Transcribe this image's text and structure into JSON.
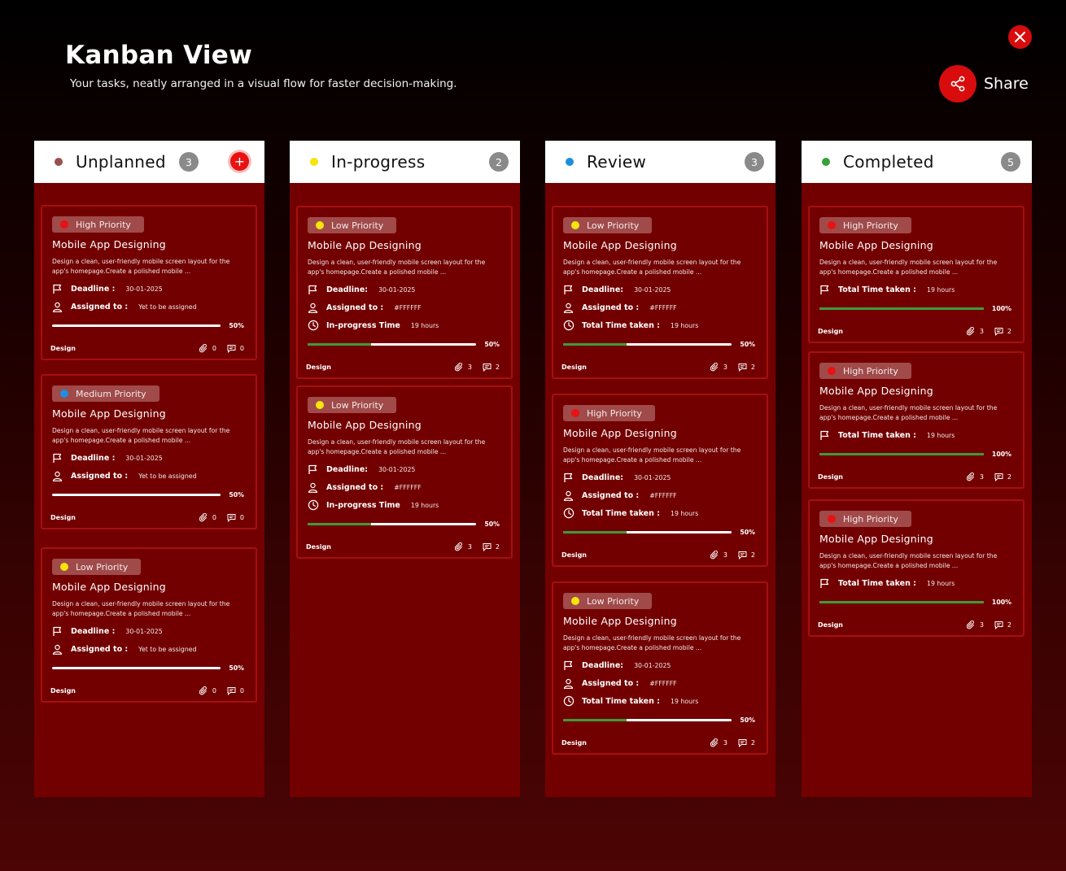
{
  "header": {
    "title": "Kanban View",
    "subtitle": "Your tasks, neatly arranged in a visual flow for faster decision-making.",
    "share_label": "Share"
  },
  "colors": {
    "red": "#e81212",
    "yellow": "#f6e40b",
    "blue": "#1e8fe0",
    "green": "#35a23a",
    "unplanned": "#9a4e4e"
  },
  "columns": [
    {
      "title": "Unplanned",
      "count": "3",
      "cards": [
        {
          "priority": "High Priority",
          "title": "Mobile App Designing",
          "desc": "Design a clean, user-friendly mobile screen layout for the app's homepage.Create a polished mobile ...",
          "deadline_label": "Deadline :",
          "deadline": "30-01-2025",
          "assigned_label": "Assigned to :",
          "assigned": "Yet to be assigned",
          "progress": "50%",
          "progress_value": 0,
          "tag": "Design",
          "attachments": "0",
          "comments": "0"
        },
        {
          "priority": "Medium Priority",
          "title": "Mobile App Designing",
          "desc": "Design a clean, user-friendly mobile screen layout for the app's homepage.Create a polished mobile ...",
          "deadline_label": "Deadline :",
          "deadline": "30-01-2025",
          "assigned_label": "Assigned to :",
          "assigned": "Yet to be assigned",
          "progress": "50%",
          "progress_value": 0,
          "tag": "Design",
          "attachments": "0",
          "comments": "0"
        },
        {
          "priority": "Low Priority",
          "title": "Mobile App Designing",
          "desc": "Design a clean, user-friendly mobile screen layout for the app's homepage.Create a polished mobile ...",
          "deadline_label": "Deadline :",
          "deadline": "30-01-2025",
          "assigned_label": "Assigned to :",
          "assigned": "Yet to be assigned",
          "progress": "50%",
          "progress_value": 0,
          "tag": "Design",
          "attachments": "0",
          "comments": "0"
        }
      ]
    },
    {
      "title": "In-progress",
      "count": "2",
      "cards": [
        {
          "priority": "Low Priority",
          "title": "Mobile App Designing",
          "desc": "Design a clean, user-friendly mobile screen layout for the app's homepage.Create a polished mobile ...",
          "deadline_label": "Deadline:",
          "deadline": "30-01-2025",
          "assigned_label": "Assigned to :",
          "assigned": "#FFFFFF",
          "time_label": "In-progress Time",
          "time": "19 hours",
          "progress": "50%",
          "progress_value": 0.375,
          "tag": "Design",
          "attachments": "3",
          "comments": "2"
        },
        {
          "priority": "Low Priority",
          "title": "Mobile App Designing",
          "desc": "Design a clean, user-friendly mobile screen layout for the app's homepage.Create a polished mobile ...",
          "deadline_label": "Deadline:",
          "deadline": "30-01-2025",
          "assigned_label": "Assigned to :",
          "assigned": "#FFFFFF",
          "time_label": "In-progress Time",
          "time": "19 hours",
          "progress": "50%",
          "progress_value": 0.375,
          "tag": "Design",
          "attachments": "3",
          "comments": "2"
        }
      ]
    },
    {
      "title": "Review",
      "count": "3",
      "cards": [
        {
          "priority": "Low Priority",
          "title": "Mobile App Designing",
          "desc": "Design a clean, user-friendly mobile screen layout for the app's homepage.Create a polished mobile ...",
          "deadline_label": "Deadline:",
          "deadline": "30-01-2025",
          "assigned_label": "Assigned to :",
          "assigned": "#FFFFFF",
          "time_label": "Total Time taken :",
          "time": "19 hours",
          "progress": "50%",
          "progress_value": 0.375,
          "tag": "Design",
          "attachments": "3",
          "comments": "2"
        },
        {
          "priority": "High Priority",
          "title": "Mobile App Designing",
          "desc": "Design a clean, user-friendly mobile screen layout for the app's homepage.Create a polished mobile ...",
          "deadline_label": "Deadline:",
          "deadline": "30-01-2025",
          "assigned_label": "Assigned to :",
          "assigned": "#FFFFFF",
          "time_label": "Total Time taken :",
          "time": "19 hours",
          "progress": "50%",
          "progress_value": 0.375,
          "tag": "Design",
          "attachments": "3",
          "comments": "2"
        },
        {
          "priority": "Low Priority",
          "title": "Mobile App Designing",
          "desc": "Design a clean, user-friendly mobile screen layout for the app's homepage.Create a polished mobile ...",
          "deadline_label": "Deadline:",
          "deadline": "30-01-2025",
          "assigned_label": "Assigned to :",
          "assigned": "#FFFFFF",
          "time_label": "Total Time taken :",
          "time": "19 hours",
          "progress": "50%",
          "progress_value": 0.375,
          "tag": "Design",
          "attachments": "3",
          "comments": "2"
        }
      ]
    },
    {
      "title": "Completed",
      "count": "5",
      "cards": [
        {
          "priority": "High Priority",
          "title": "Mobile App Designing",
          "desc": "Design a clean, user-friendly mobile screen layout for the app's homepage.Create a polished mobile ...",
          "time_label": "Total Time taken :",
          "time": "19 hours",
          "progress": "100%",
          "progress_value": 1,
          "tag": "Design",
          "attachments": "3",
          "comments": "2"
        },
        {
          "priority": "High Priority",
          "title": "Mobile App Designing",
          "desc": "Design a clean, user-friendly mobile screen layout for the app's homepage.Create a polished mobile ...",
          "time_label": "Total Time taken :",
          "time": "19 hours",
          "progress": "100%",
          "progress_value": 1,
          "tag": "Design",
          "attachments": "3",
          "comments": "2"
        },
        {
          "priority": "High Priority",
          "title": "Mobile App Designing",
          "desc": "Design a clean, user-friendly mobile screen layout for the app's homepage.Create a polished mobile ...",
          "time_label": "Total Time taken :",
          "time": "19 hours",
          "progress": "100%",
          "progress_value": 1,
          "tag": "Design",
          "attachments": "3",
          "comments": "2"
        }
      ]
    }
  ]
}
